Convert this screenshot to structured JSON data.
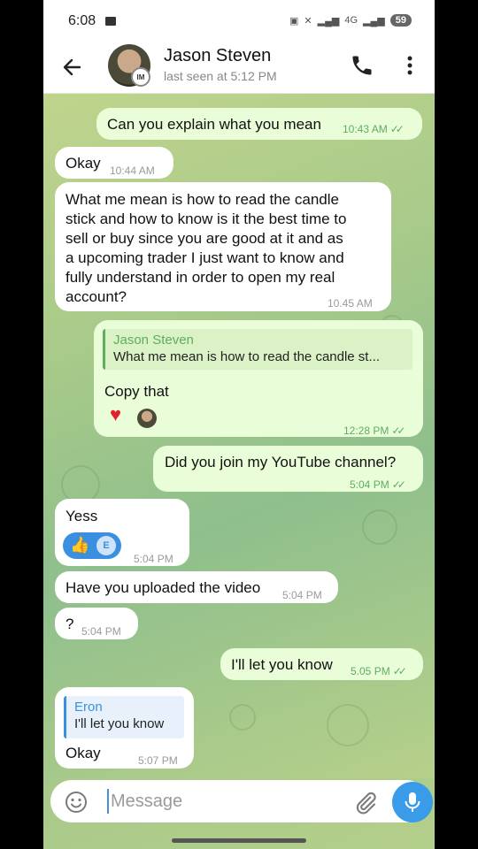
{
  "status_bar": {
    "time": "6:08",
    "network": "4G",
    "battery": "59"
  },
  "header": {
    "contact_name": "Jason Steven",
    "last_seen": "last seen at 5:12 PM",
    "avatar_badge": "IM"
  },
  "messages": [
    {
      "dir": "out",
      "text": "Can you explain what you mean",
      "time": "10:43 AM",
      "read": true
    },
    {
      "dir": "in",
      "text": "Okay",
      "time": "10:44 AM"
    },
    {
      "dir": "in",
      "lines": [
        "What me mean is how to read the candle",
        "stick and how to know is it the best time to",
        "sell or buy since you are good at it and as",
        "a upcoming trader I just want to know and",
        "fully understand in order to open my real",
        "account?"
      ],
      "time": "10.45 AM"
    },
    {
      "dir": "out",
      "reply_name": "Jason Steven",
      "reply_text": "What me mean is how to read the candle st...",
      "text": "Copy that",
      "reaction": "heart",
      "time": "12:28 PM",
      "read": true
    },
    {
      "dir": "out",
      "text": "Did you join my YouTube channel?",
      "time": "5:04 PM",
      "read": true
    },
    {
      "dir": "in",
      "text": "Yess",
      "reaction_label": "E",
      "reaction_icon": "thumbs-up",
      "time": "5:04 PM"
    },
    {
      "dir": "in",
      "text": "Have you uploaded the video",
      "time": "5:04 PM"
    },
    {
      "dir": "in",
      "text": "?",
      "time": "5:04 PM"
    },
    {
      "dir": "out",
      "text": "I'll let you know",
      "time": "5.05 PM",
      "read": true
    },
    {
      "dir": "in",
      "reply_name": "Eron",
      "reply_text": "I'll let you know",
      "text": "Okay",
      "time": "5:07 PM"
    }
  ],
  "composer": {
    "placeholder": "Message"
  },
  "colors": {
    "accent": "#3a9be8",
    "in_bubble": "#ffffff",
    "out_bubble": "#eafdd9",
    "reply_accent": "#5fad5f",
    "reply_accent_in": "#3b8fe0"
  },
  "icons": [
    "back-arrow-icon",
    "phone-icon",
    "more-vertical-icon",
    "emoji-icon",
    "attach-icon",
    "mic-icon",
    "cast-icon",
    "double-check-icon",
    "heart-icon",
    "thumbs-up-icon"
  ]
}
